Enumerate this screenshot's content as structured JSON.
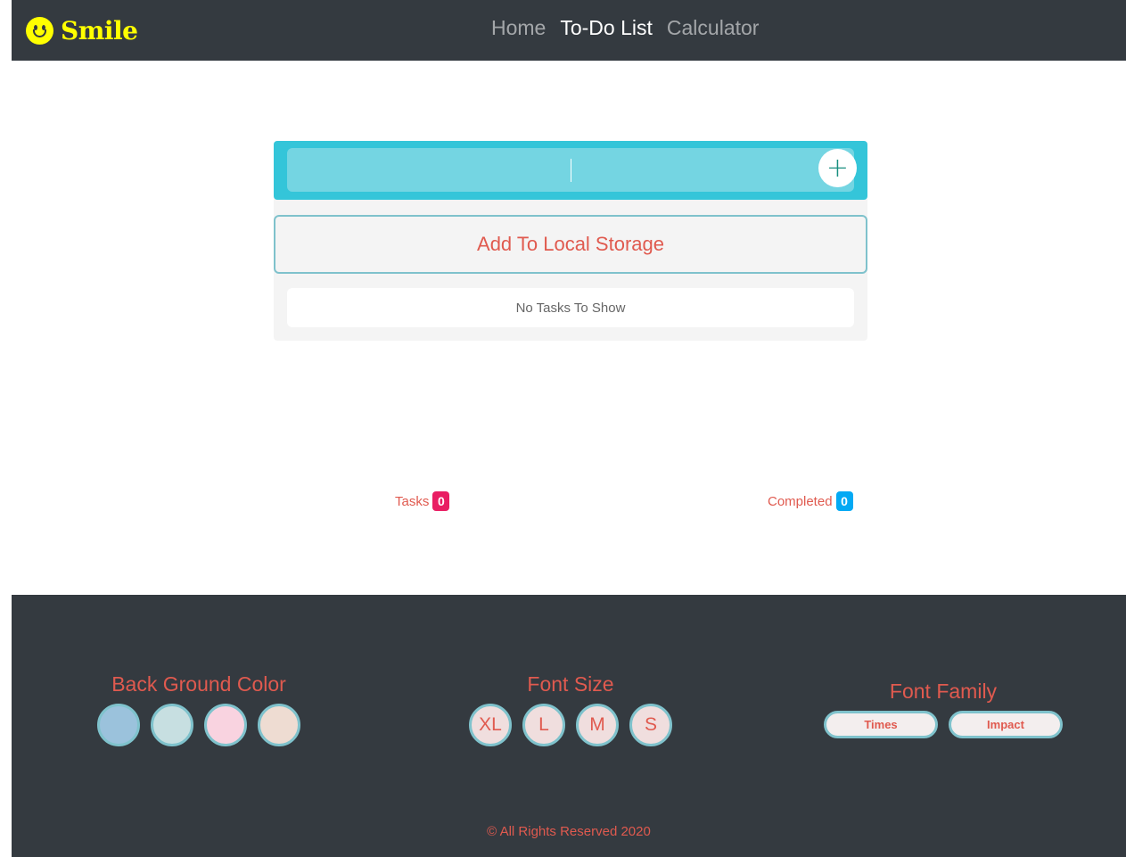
{
  "navbar": {
    "brand": "Smile",
    "links": [
      {
        "label": "Home",
        "active": false
      },
      {
        "label": "To-Do List",
        "active": true
      },
      {
        "label": "Calculator",
        "active": false
      }
    ]
  },
  "todo": {
    "input_value": "",
    "add_icon": "plus-icon",
    "add_symbol": "+",
    "storage_button": "Add To Local Storage",
    "empty_message": "No Tasks To Show"
  },
  "counters": {
    "tasks_label": "Tasks",
    "tasks_count": "0",
    "completed_label": "Completed",
    "completed_count": "0"
  },
  "footer": {
    "bg_title": "Back Ground Color",
    "bg_colors": [
      "#9bc2dc",
      "#c7dfe1",
      "#f9d3e0",
      "#eedcd2"
    ],
    "size_title": "Font Size",
    "sizes": [
      "XL",
      "L",
      "M",
      "S"
    ],
    "family_title": "Font Family",
    "families": [
      "Times",
      "Impact"
    ],
    "copyright": "© All Rights Reserved 2020"
  },
  "colors": {
    "navbar_bg": "#343a40",
    "brand": "#ffff00",
    "accent_text": "#e05a4f",
    "input_bar": "#34c5d9",
    "badge_tasks": "#e91e63",
    "badge_completed": "#03a9f4"
  }
}
